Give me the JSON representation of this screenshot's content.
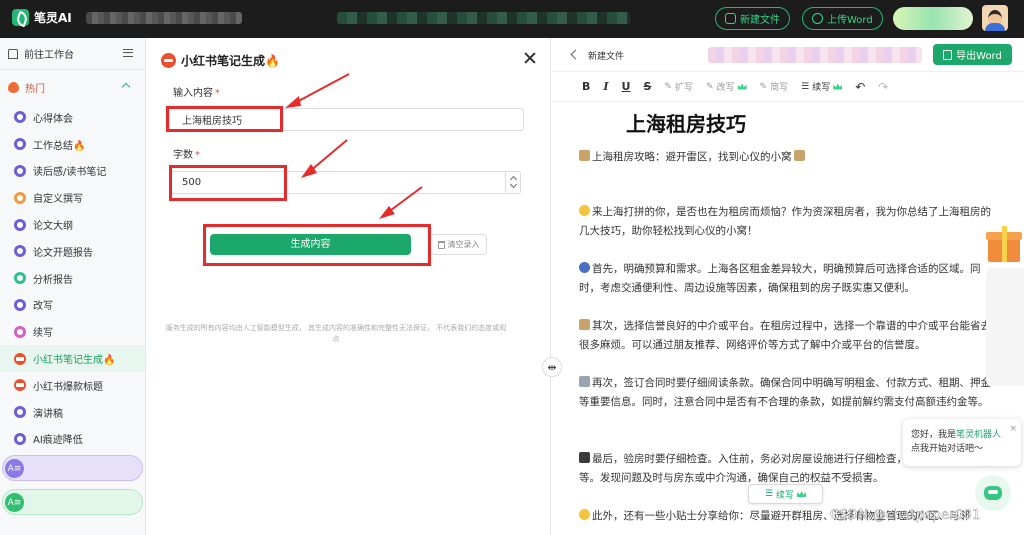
{
  "app": {
    "name": "笔灵AI"
  },
  "header": {
    "new_file_label": "新建文件",
    "upload_word_label": "上传Word"
  },
  "sidebar": {
    "home_label": "前往工作台",
    "section_label": "热门",
    "items": [
      {
        "label": "心得体会",
        "icon": "purple"
      },
      {
        "label": "工作总结🔥",
        "icon": "purple"
      },
      {
        "label": "读后感/读书笔记",
        "icon": "purple"
      },
      {
        "label": "自定义撰写",
        "icon": "orange"
      },
      {
        "label": "论文大纲",
        "icon": "purple"
      },
      {
        "label": "论文开题报告",
        "icon": "purple"
      },
      {
        "label": "分析报告",
        "icon": "green"
      },
      {
        "label": "改写",
        "icon": "purple"
      },
      {
        "label": "续写",
        "icon": "pink"
      },
      {
        "label": "小红书笔记生成🔥",
        "icon": "red",
        "active": true
      },
      {
        "label": "小红书爆款标题",
        "icon": "red"
      },
      {
        "label": "演讲稿",
        "icon": "purple"
      },
      {
        "label": "AI痕迹降低",
        "icon": "purple"
      }
    ]
  },
  "form": {
    "title": "小红书笔记生成🔥",
    "content_label": "输入内容",
    "required_mark": "*",
    "content_value": "上海租房技巧",
    "wordcount_label": "字数",
    "wordcount_value": "500",
    "generate_label": "生成内容",
    "clear_label": "清空录入",
    "disclaimer": "服务生成的所有内容均由人工智能模型生成， 其生成内容的准确性和完整性无法保证， 不代表我们的态度或观点"
  },
  "editor": {
    "doc_name": "新建文件",
    "export_label": "导出Word",
    "toolbar": {
      "bold": "B",
      "italic": "I",
      "underline": "U",
      "strike": "S",
      "expand": "扩写",
      "rewrite": "改写",
      "shorten": "简写",
      "continue": "续写",
      "undo": "↶",
      "redo": "↷"
    },
    "heading": "上海租房技巧",
    "paragraphs": [
      "上海租房攻略：避开雷区，找到心仪的小窝",
      "来上海打拼的你，是否也在为租房而烦恼？作为资深租房者，我为你总结了上海租房的几大技巧，助你轻松找到心仪的小窝！",
      "首先，明确预算和需求。上海各区租金差异较大，明确预算后可选择合适的区域。同时，考虑交通便利性、周边设施等因素，确保租到的房子既实惠又便利。",
      "其次，选择信誉良好的中介或平台。在租房过程中，选择一个靠谱的中介或平台能省去很多麻烦。可以通过朋友推荐、网络评价等方式了解中介或平台的信誉度。",
      "再次，签订合同时要仔细阅读条款。确保合同中明确写明租金、付款方式、租期、押金等重要信息。同时，注意合同中是否有不合理的条款，如提前解约需支付高额违约金等。",
      "最后，验房时要仔细检查。入住前，务必对房屋设施进行仔细检查，包括水电、门窗等。发现问题及时与房东或中介沟通，确保自己的权益不受损害。",
      "此外，还有一些小贴士分享给你：尽量避开群租房、选择有物业管理的小区、与邻"
    ],
    "continue_pill": "续写"
  },
  "chat": {
    "greeting_prefix": "您好，我是",
    "bot_name": "笔灵机器人",
    "greeting_suffix": "点我开始对话吧～",
    "close": "×"
  },
  "watermark": "CSDN @chatpaper001",
  "colors": {
    "accent": "#1ba86a",
    "annotation_red": "#e52b2b",
    "topbar": "#1c1c1c"
  }
}
